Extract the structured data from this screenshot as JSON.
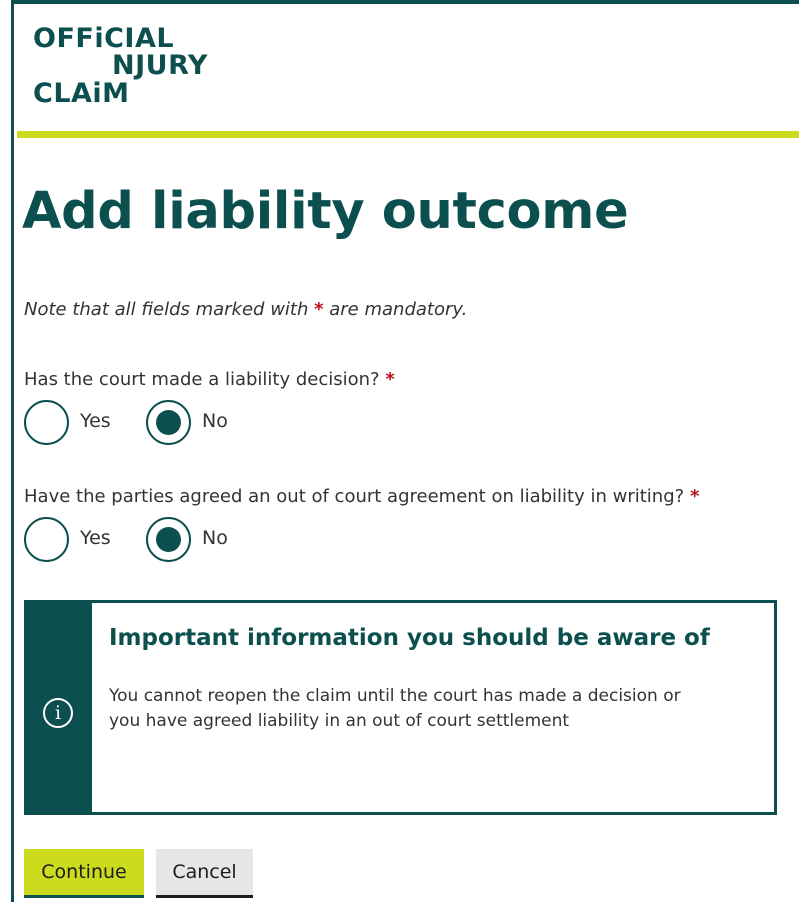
{
  "logo": {
    "line1": "OFFiCIAL",
    "line2": "NJURY",
    "line3": "CLAiM",
    "alt": "Official Injury Claim"
  },
  "page": {
    "title": "Add liability outcome",
    "note_prefix": "Note that all fields marked with ",
    "note_required_mark": "*",
    "note_suffix": " are mandatory."
  },
  "questions": [
    {
      "label": "Has the court made a liability decision?",
      "required_mark": "*",
      "options": [
        {
          "label": "Yes",
          "checked": false
        },
        {
          "label": "No",
          "checked": true
        }
      ]
    },
    {
      "label": "Have the parties agreed an out of court agreement on liability in writing?",
      "required_mark": "*",
      "options": [
        {
          "label": "Yes",
          "checked": false
        },
        {
          "label": "No",
          "checked": true
        }
      ]
    }
  ],
  "info": {
    "icon": "info-icon",
    "title": "Important information you should be aware of",
    "body": "You cannot reopen the claim until the court has made a decision or you have agreed liability in an out of court settlement"
  },
  "actions": {
    "continue_label": "Continue",
    "cancel_label": "Cancel"
  },
  "colors": {
    "brand_teal": "#0b4f4e",
    "accent_lime": "#cddb1f",
    "required_red": "#b5121b"
  }
}
